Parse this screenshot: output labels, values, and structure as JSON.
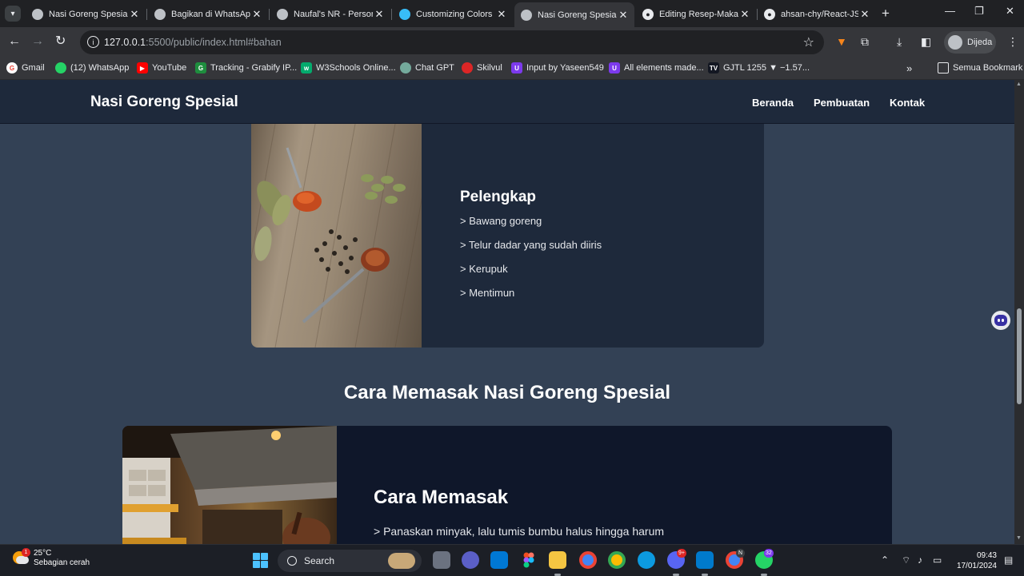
{
  "browser": {
    "tabs": [
      {
        "label": "Nasi Goreng Spesial",
        "icon": "globe-icon",
        "active": false
      },
      {
        "label": "Bagikan di WhatsApp",
        "icon": "globe-icon",
        "active": false
      },
      {
        "label": "Naufal's NR - Person",
        "icon": "globe-icon",
        "active": false
      },
      {
        "label": "Customizing Colors",
        "icon": "tailwind-icon",
        "active": false
      },
      {
        "label": "Nasi Goreng Spesial",
        "icon": "globe-icon",
        "active": true
      },
      {
        "label": "Editing Resep-Makan",
        "icon": "github-icon",
        "active": false
      },
      {
        "label": "ahsan-chy/React-JS-",
        "icon": "github-icon",
        "active": false
      }
    ],
    "address": {
      "host": "127.0.0.1",
      "rest": ":5500/public/index.html#bahan"
    },
    "profile_label": "Dijeda",
    "bookmarks": [
      {
        "label": "Gmail",
        "icon": "google-icon"
      },
      {
        "label": "(12) WhatsApp",
        "icon": "whatsapp-icon"
      },
      {
        "label": "YouTube",
        "icon": "youtube-icon"
      },
      {
        "label": "Tracking - Grabify IP...",
        "icon": "grabify-icon"
      },
      {
        "label": "W3Schools Online...",
        "icon": "w3schools-icon"
      },
      {
        "label": "Chat GPT",
        "icon": "chatgpt-icon"
      },
      {
        "label": "Skilvul",
        "icon": "skilvul-icon"
      },
      {
        "label": "Input by Yaseen549",
        "icon": "uiverse-icon"
      },
      {
        "label": "All elements made...",
        "icon": "uiverse-icon"
      },
      {
        "label": "GJTL 1255 ▼ −1.57...",
        "icon": "tradingview-icon"
      }
    ],
    "all_bookmarks_label": "Semua Bookmark"
  },
  "site": {
    "title": "Nasi Goreng Spesial",
    "nav": [
      "Beranda",
      "Pembuatan",
      "Kontak"
    ],
    "pelengkap": {
      "title": "Pelengkap",
      "items": [
        "> Bawang goreng",
        "> Telur dadar yang sudah diiris",
        "> Kerupuk",
        "> Mentimun"
      ]
    },
    "section_heading": "Cara Memasak Nasi Goreng Spesial",
    "cara": {
      "title": "Cara Memasak",
      "items": [
        "> Panaskan minyak, lalu tumis bumbu halus hingga harum"
      ]
    }
  },
  "taskbar": {
    "weather": {
      "temp": "25°C",
      "desc": "Sebagian cerah",
      "badge": "1"
    },
    "search_label": "Search",
    "badges": {
      "discord": "9+",
      "chrome_profile": "N",
      "whatsapp": "32"
    },
    "time": "09:43",
    "date": "17/01/2024"
  },
  "colors": {
    "page_bg": "#334155",
    "header_bg": "#1e293b",
    "card_bg": "#1e293b",
    "card2_bg": "#0f172a"
  }
}
